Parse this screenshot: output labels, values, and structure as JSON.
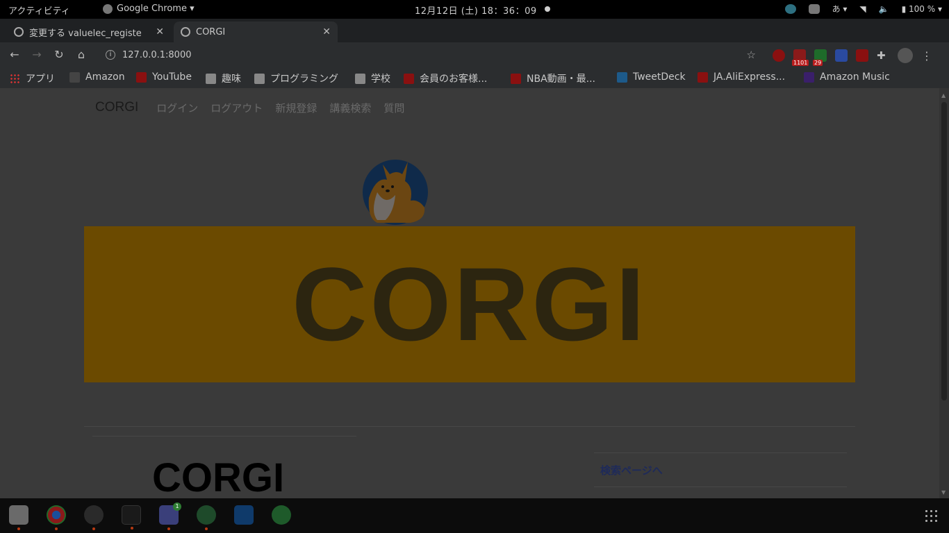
{
  "topbar": {
    "activities": "アクティビティ",
    "app_name": "Google Chrome ▾",
    "clock": "12月12日 (土)  18：36：09",
    "input_method": "あ ▾",
    "battery": "100 %"
  },
  "browser": {
    "tabs": [
      {
        "title": "変更する valuelec_registe",
        "active": false
      },
      {
        "title": "CORGI",
        "active": true
      }
    ],
    "url": "127.0.0.1:8000",
    "extension_badges": {
      "gmail": "1101",
      "line": "29"
    }
  },
  "bookmarks": [
    {
      "label": "アプリ",
      "icon": "apps-grid-icon"
    },
    {
      "label": "Amazon",
      "icon": "amazon-icon"
    },
    {
      "label": "YouTube",
      "icon": "youtube-icon"
    },
    {
      "label": "趣味",
      "icon": "folder-icon"
    },
    {
      "label": "プログラミング",
      "icon": "folder-icon"
    },
    {
      "label": "学校",
      "icon": "folder-icon"
    },
    {
      "label": "会員のお客様...",
      "icon": "y-icon"
    },
    {
      "label": "NBA動画・最...",
      "icon": "rakuten-icon"
    },
    {
      "label": "TweetDeck",
      "icon": "tweetdeck-icon"
    },
    {
      "label": "JA.AliExpress...",
      "icon": "aliexpress-icon"
    },
    {
      "label": "Amazon Music",
      "icon": "amazon-music-icon"
    }
  ],
  "page": {
    "navbar": {
      "brand": "CORGI",
      "links": [
        "ログイン",
        "ログアウト",
        "新規登録",
        "講義検索",
        "質問"
      ]
    },
    "hero_text": "CORGI",
    "section_heading": "CORGI",
    "side_link": "検索ページへ"
  },
  "colors": {
    "hero_bg_dimmed": "#6b4a00",
    "hero_text": "#2c2510",
    "side_link": "#1e2a5a"
  },
  "dock": [
    "files-icon",
    "chrome-icon",
    "slack-icon",
    "terminal-icon",
    "discord-icon",
    "vpn-icon",
    "webstorm-icon",
    "maps-icon"
  ],
  "dock_discord_badge": "1"
}
